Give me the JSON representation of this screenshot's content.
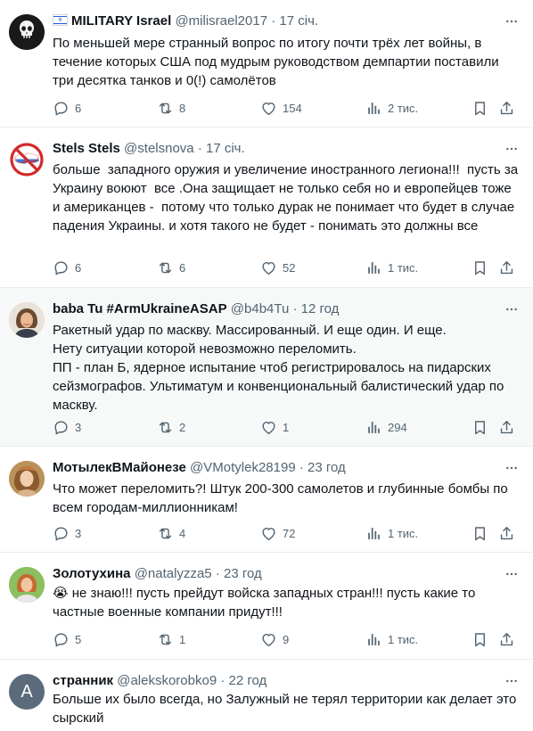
{
  "tweets": [
    {
      "name": "MILITARY Israel",
      "handle": "@milisrael2017",
      "dot": "·",
      "time": "17 січ.",
      "text": "По меньшей мере странный вопрос по итогу почти трёх лет войны, в течение которых США под мудрым руководством демпартии поставили три десятка танков и 0(!) самолётов",
      "replies": "6",
      "retweets": "8",
      "likes": "154",
      "views": "2 тис."
    },
    {
      "name": "Stels Stels",
      "handle": "@stelsnova",
      "dot": "·",
      "time": "17 січ.",
      "text": "больше  западного оружия и увеличение иностранного легиона!!!  пусть за Украину воюют  все .Она защищает не только себя но и европейцев тоже  и американцев -  потому что только дурак не понимает что будет в случае падения Украины. и хотя такого не будет - понимать это должны все",
      "replies": "6",
      "retweets": "6",
      "likes": "52",
      "views": "1 тис."
    },
    {
      "name": "baba Tu #ArmUkraineASAP",
      "handle": "@b4b4Tu",
      "dot": "·",
      "time": "12 год",
      "text": "Ракетный удар по маскву. Массированный. И еще один. И еще.\nНету ситуации которой невозможно переломить.\nПП - план Б, ядерное испытание чтоб регистрировалось на пидарских сейзмографов. Ультиматум и конвенциональный балистический удар по маскву.",
      "replies": "3",
      "retweets": "2",
      "likes": "1",
      "views": "294"
    },
    {
      "name": "МотылекВМайонезе",
      "handle": "@VMotylek28199",
      "dot": "·",
      "time": "23 год",
      "text": "Что может переломить?! Штук 200-300 самолетов и глубинные бомбы по всем городам-миллионникам!",
      "replies": "3",
      "retweets": "4",
      "likes": "72",
      "views": "1 тис."
    },
    {
      "name": "Золотухина",
      "handle": "@natalyzza5",
      "dot": "·",
      "time": "23 год",
      "text": "😭 не знаю!!! пусть прейдут войска западных стран!!! пусть какие то частные военные компании придут!!!",
      "replies": "5",
      "retweets": "1",
      "likes": "9",
      "views": "1 тис."
    },
    {
      "name": "странник",
      "handle": "@alekskorobko9",
      "dot": "·",
      "time": "22 год",
      "text": "Больше их было всегда, но Залужный не терял территории как делает это сырский",
      "avatar_letter": "А"
    }
  ],
  "colors": {
    "text": "#0f1419",
    "muted": "#536471",
    "divider": "#e6ecf0",
    "highlight_bg": "#f7f9f9"
  }
}
